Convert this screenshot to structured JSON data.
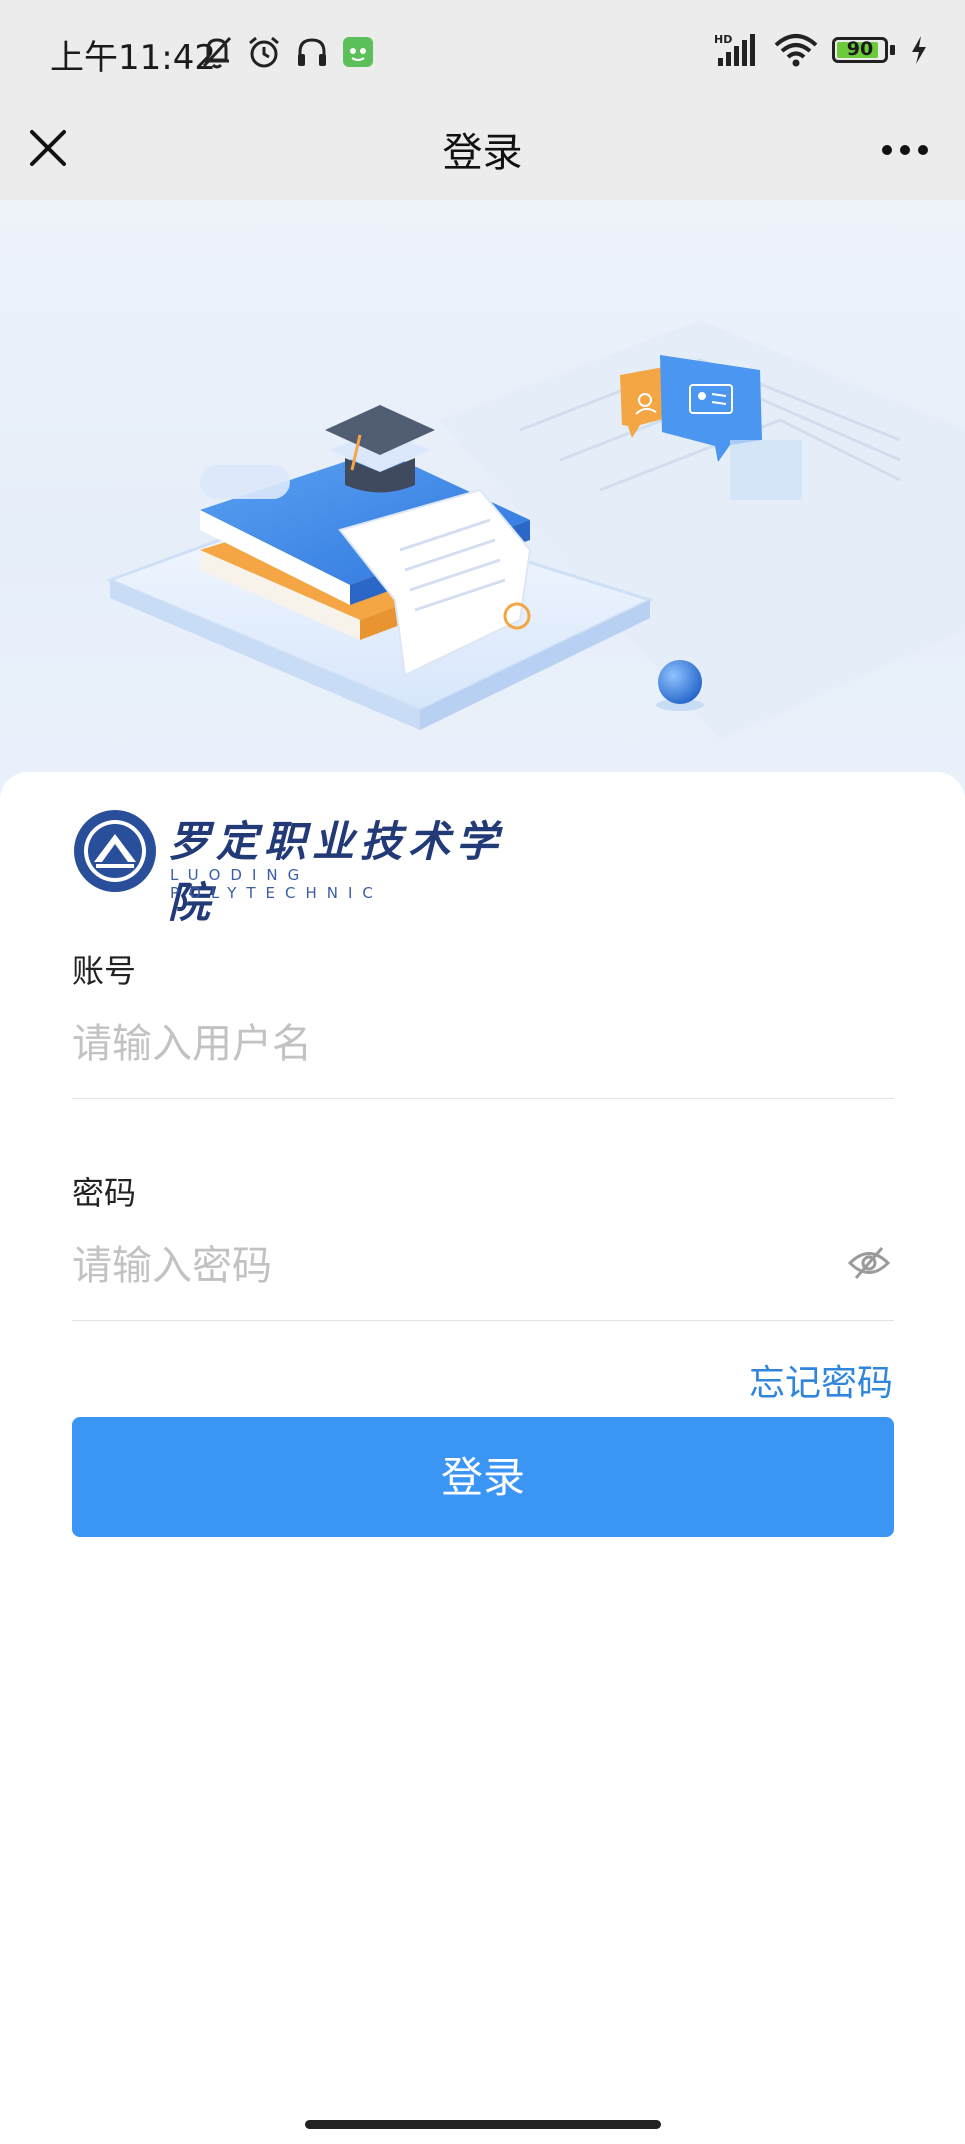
{
  "status_bar": {
    "time": "上午11:42",
    "network": "HD",
    "battery_level": "90",
    "battery_percent": 90,
    "icons": [
      "bell-muted-icon",
      "alarm-icon",
      "headphones-icon",
      "app-notification-icon",
      "signal-icon",
      "wifi-icon",
      "battery-icon",
      "charging-icon"
    ]
  },
  "nav": {
    "title": "登录",
    "close_icon": "close-icon",
    "more_icon": "more-icon"
  },
  "logo": {
    "name_cn": "罗定职业技术学院",
    "name_en": "LUODING POLYTECHNIC"
  },
  "form": {
    "account_label": "账号",
    "account_placeholder": "请输入用户名",
    "account_value": "",
    "password_label": "密码",
    "password_placeholder": "请输入密码",
    "password_value": "",
    "forgot_link": "忘记密码",
    "submit_label": "登录"
  },
  "colors": {
    "primary": "#3a95f5",
    "link": "#2f86dc",
    "bar_bg": "#ececec",
    "battery_fill": "#6ccb3b"
  }
}
